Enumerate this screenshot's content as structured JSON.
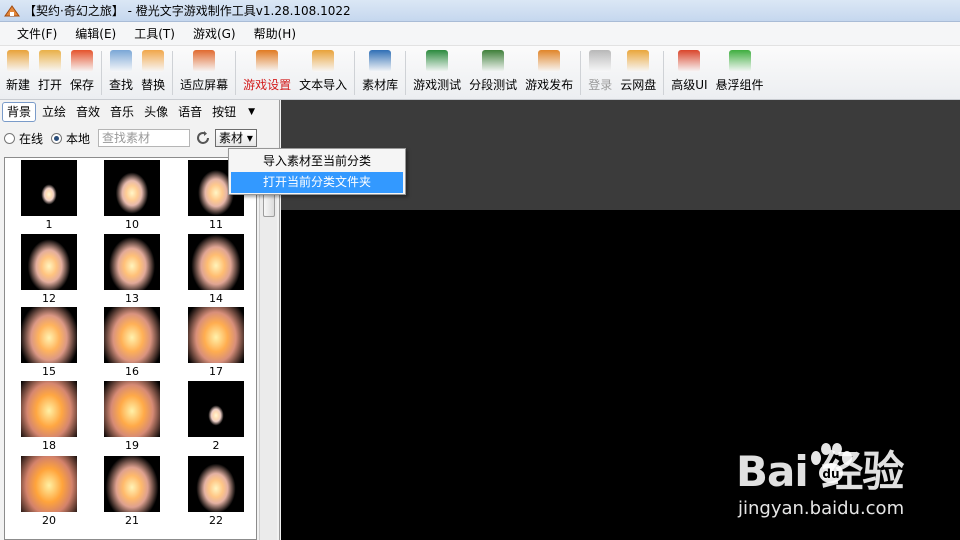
{
  "window": {
    "title": "【契约·奇幻之旅】 - 橙光文字游戏制作工具v1.28.108.1022"
  },
  "menu": [
    {
      "label": "文件(F)"
    },
    {
      "label": "编辑(E)"
    },
    {
      "label": "工具(T)"
    },
    {
      "label": "游戏(G)"
    },
    {
      "label": "帮助(H)"
    }
  ],
  "toolbar": {
    "items": [
      {
        "label": "新建",
        "icon": "new-file-icon",
        "color": "#e8a23a"
      },
      {
        "label": "打开",
        "icon": "open-folder-icon",
        "color": "#e9b048"
      },
      {
        "label": "保存",
        "icon": "save-icon",
        "color": "#e4532c"
      },
      {
        "label": "查找",
        "icon": "find-icon",
        "color": "#7aa6d6"
      },
      {
        "label": "替换",
        "icon": "replace-icon",
        "color": "#f0a64a"
      },
      {
        "label": "适应屏幕",
        "icon": "fit-screen-icon",
        "color": "#e06a2f"
      },
      {
        "label": "游戏设置",
        "icon": "gear-icon",
        "color": "#e07a22"
      },
      {
        "label": "文本导入",
        "icon": "text-import-icon",
        "color": "#e8a23a"
      },
      {
        "label": "素材库",
        "icon": "asset-library-icon",
        "color": "#2f6fb5"
      },
      {
        "label": "游戏测试",
        "icon": "game-test-icon",
        "color": "#2b8a3e"
      },
      {
        "label": "分段测试",
        "icon": "segment-test-icon",
        "color": "#3f7f3a"
      },
      {
        "label": "游戏发布",
        "icon": "publish-icon",
        "color": "#e0852a"
      },
      {
        "label": "登录",
        "icon": "login-icon",
        "color": "#b8b8b8"
      },
      {
        "label": "云网盘",
        "icon": "cloud-disk-icon",
        "color": "#e9a63c"
      },
      {
        "label": "高级UI",
        "icon": "advanced-ui-icon",
        "color": "#d9452b"
      },
      {
        "label": "悬浮组件",
        "icon": "float-widget-icon",
        "color": "#3fae3f"
      }
    ]
  },
  "left_panel": {
    "tabs": [
      {
        "label": "背景"
      },
      {
        "label": "立绘"
      },
      {
        "label": "音效"
      },
      {
        "label": "音乐"
      },
      {
        "label": "头像"
      },
      {
        "label": "语音"
      },
      {
        "label": "按钮"
      }
    ],
    "source": {
      "online_label": "在线",
      "local_label": "本地",
      "selected": "本地"
    },
    "search_placeholder": "查找素材",
    "category_button": "素材 ▾",
    "thumbnails": [
      {
        "label": "1",
        "intensity": 0.05
      },
      {
        "label": "10",
        "intensity": 0.3
      },
      {
        "label": "11",
        "intensity": 0.35
      },
      {
        "label": "12",
        "intensity": 0.45
      },
      {
        "label": "13",
        "intensity": 0.5
      },
      {
        "label": "14",
        "intensity": 0.55
      },
      {
        "label": "15",
        "intensity": 0.7
      },
      {
        "label": "16",
        "intensity": 0.75
      },
      {
        "label": "17",
        "intensity": 0.8
      },
      {
        "label": "18",
        "intensity": 0.9
      },
      {
        "label": "19",
        "intensity": 0.85
      },
      {
        "label": "2",
        "intensity": 0.05
      },
      {
        "label": "20",
        "intensity": 0.95
      },
      {
        "label": "21",
        "intensity": 0.6
      },
      {
        "label": "22",
        "intensity": 0.4
      }
    ]
  },
  "context_menu": {
    "items": [
      {
        "label": "导入素材至当前分类",
        "selected": false
      },
      {
        "label": "打开当前分类文件夹",
        "selected": true
      }
    ]
  },
  "watermark": {
    "logo": "Bai  经验",
    "url": "jingyan.baidu.com"
  },
  "colors": {
    "accent_red": "#d31c1c",
    "menu_highlight": "#3399ff"
  }
}
